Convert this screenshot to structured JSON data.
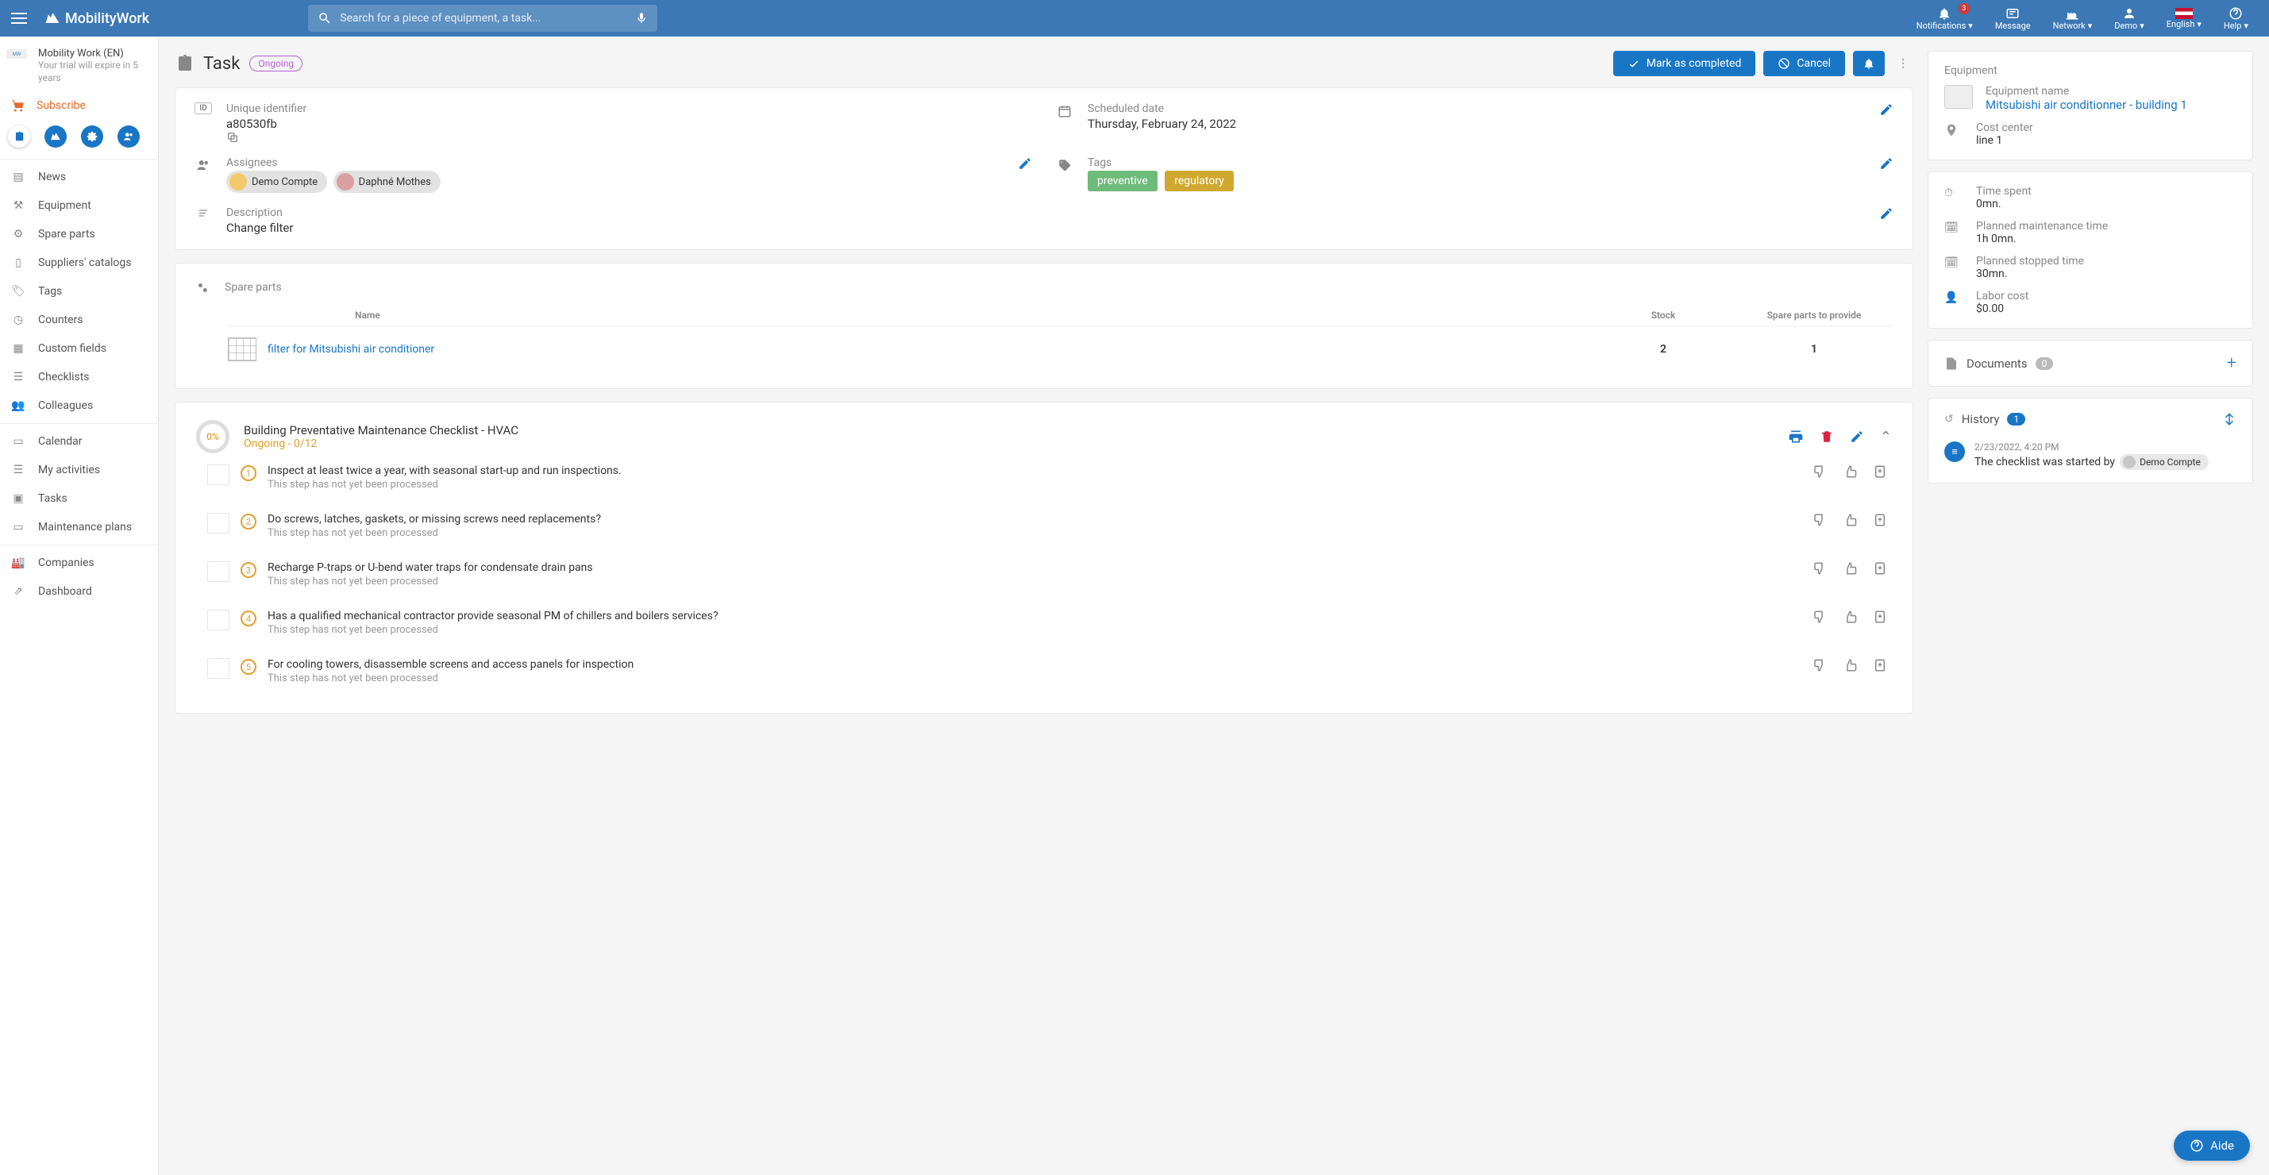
{
  "topbar": {
    "brand": "MobilityWork",
    "search_placeholder": "Search for a piece of equipment, a task...",
    "notifications": {
      "label": "Notifications",
      "count": "3"
    },
    "message": "Message",
    "network": "Network",
    "demo": "Demo",
    "language": "English",
    "help": "Help"
  },
  "org": {
    "name": "Mobility Work (EN)",
    "trial": "Your trial will expire in 5 years"
  },
  "subscribe_label": "Subscribe",
  "nav": {
    "news": "News",
    "equipment": "Equipment",
    "spare_parts": "Spare parts",
    "suppliers": "Suppliers' catalogs",
    "tags": "Tags",
    "counters": "Counters",
    "custom_fields": "Custom fields",
    "checklists": "Checklists",
    "colleagues": "Colleagues",
    "calendar": "Calendar",
    "activities": "My activities",
    "tasks": "Tasks",
    "plans": "Maintenance plans",
    "companies": "Companies",
    "dashboard": "Dashboard"
  },
  "page": {
    "title": "Task",
    "status": "Ongoing",
    "mark_completed": "Mark as completed",
    "cancel": "Cancel"
  },
  "details": {
    "uid_label": "Unique identifier",
    "uid_value": "a80530fb",
    "scheduled_label": "Scheduled date",
    "scheduled_value": "Thursday, February 24, 2022",
    "assignees_label": "Assignees",
    "assignees": [
      "Demo Compte",
      "Daphné Mothes"
    ],
    "tags_label": "Tags",
    "tags": [
      {
        "text": "preventive",
        "cls": "tag-green"
      },
      {
        "text": "regulatory",
        "cls": "tag-yellow"
      }
    ],
    "description_label": "Description",
    "description_value": "Change filter"
  },
  "spare": {
    "section_label": "Spare parts",
    "col_name": "Name",
    "col_stock": "Stock",
    "col_provide": "Spare parts to provide",
    "rows": [
      {
        "name": "filter for Mitsubishi air conditioner",
        "stock": "2",
        "provide": "1"
      }
    ]
  },
  "checklist": {
    "percent": "0%",
    "title": "Building Preventative Maintenance Checklist - HVAC",
    "sub": "Ongoing - 0/12",
    "not_processed": "This step has not yet been processed",
    "items": [
      "Inspect at least twice a year, with seasonal start-up and run inspections.",
      "Do screws, latches, gaskets, or missing screws need replacements?",
      "Recharge P-traps or U-bend water traps for condensate drain pans",
      "Has a qualified mechanical contractor provide seasonal PM of chillers and boilers services?",
      "For cooling towers, disassemble screens and access panels for inspection"
    ]
  },
  "equipment_panel": {
    "section": "Equipment",
    "name_label": "Equipment name",
    "name_value": "Mitsubishi air conditionner - building 1",
    "cost_label": "Cost center",
    "cost_value": "line 1"
  },
  "metrics": {
    "time_spent_label": "Time spent",
    "time_spent_value": "0mn.",
    "planned_maint_label": "Planned maintenance time",
    "planned_maint_value": "1h 0mn.",
    "planned_stop_label": "Planned stopped time",
    "planned_stop_value": "30mn.",
    "labor_label": "Labor cost",
    "labor_value": "$0.00"
  },
  "documents": {
    "label": "Documents",
    "count": "0"
  },
  "history": {
    "label": "History",
    "count": "1",
    "entries": [
      {
        "ts": "2/23/2022, 4:20 PM",
        "msg": "The checklist was started by",
        "user": "Demo Compte"
      }
    ]
  },
  "help_fab": "Aide"
}
